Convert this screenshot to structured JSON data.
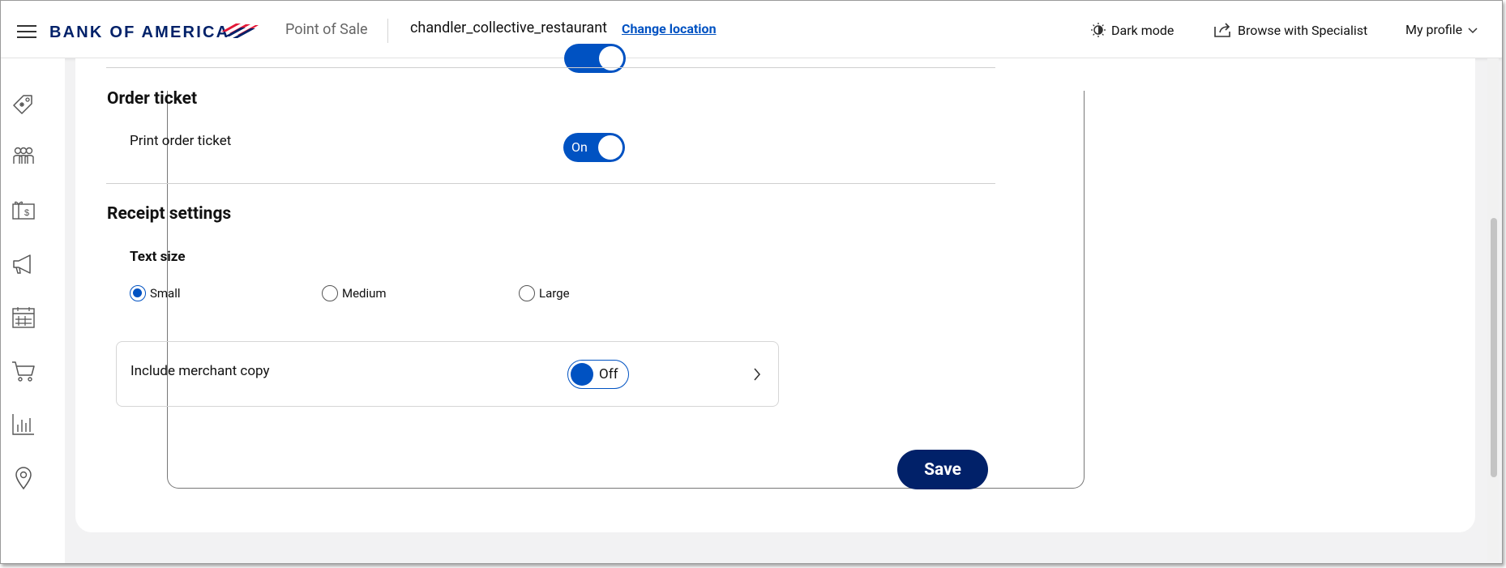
{
  "header": {
    "brand": "BANK OF AMERICA",
    "app_name": "Point of Sale",
    "location": "chandler_collective_restaurant",
    "change_location": "Change location",
    "dark_mode": "Dark mode",
    "browse_specialist": "Browse with Specialist",
    "my_profile": "My profile"
  },
  "sidebar": {
    "items": [
      {
        "icon": "tag-icon"
      },
      {
        "icon": "customers-icon"
      },
      {
        "icon": "gift-card-icon"
      },
      {
        "icon": "megaphone-icon"
      },
      {
        "icon": "calendar-icon"
      },
      {
        "icon": "cart-icon"
      },
      {
        "icon": "bar-chart-icon"
      },
      {
        "icon": "location-pin-icon"
      }
    ]
  },
  "order_ticket": {
    "title": "Order ticket",
    "print_label": "Print order ticket",
    "print_toggle": "On"
  },
  "receipt": {
    "title": "Receipt settings",
    "text_size_label": "Text size",
    "options": [
      "Small",
      "Medium",
      "Large"
    ],
    "selected": "Small",
    "merchant_copy_label": "Include merchant copy",
    "merchant_copy_toggle": "Off"
  },
  "actions": {
    "save": "Save"
  },
  "colors": {
    "brand_navy": "#012169",
    "accent_blue": "#0052c2",
    "brand_red": "#e31837"
  }
}
